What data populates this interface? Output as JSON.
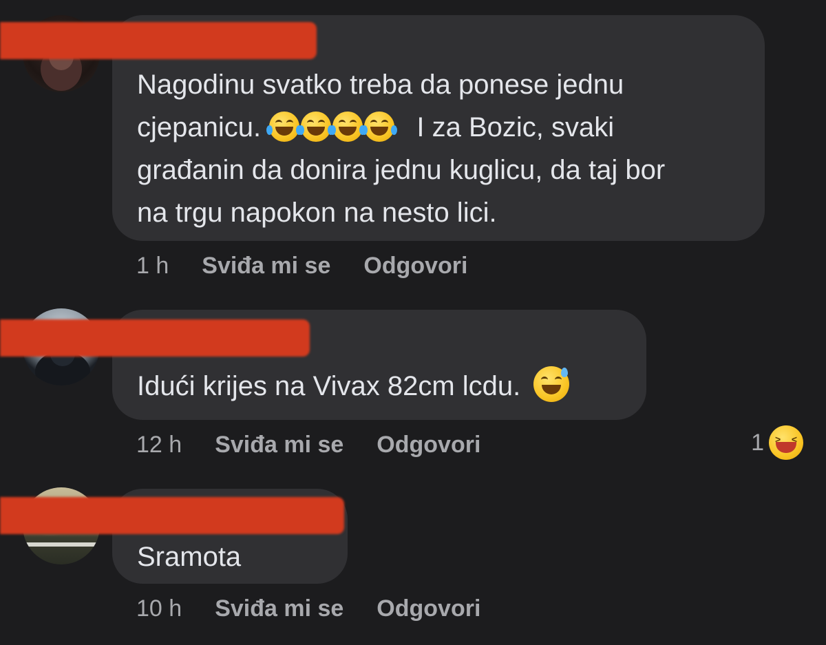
{
  "comments": [
    {
      "text_1": "Nagodinu svatko treba da ponese jednu",
      "text_2": "cjepanicu.",
      "text_2b": "I za Bozic, svaki",
      "text_3": "građanin da donira jednu kuglicu, da taj bor",
      "text_4": "na trgu napokon na nesto lici.",
      "emoji": "tears-of-joy-icon",
      "time": "1 h",
      "like": "Sviđa mi se",
      "reply": "Odgovori"
    },
    {
      "text_1": "Idući krijes na Vivax 82cm lcdu.",
      "emoji": "grinning-sweat-icon",
      "time": "12 h",
      "like": "Sviđa mi se",
      "reply": "Odgovori",
      "reaction_count": "1",
      "reaction_emoji": "laughing-squint-icon"
    },
    {
      "text_1": "Sramota",
      "time": "10 h",
      "like": "Sviđa mi se",
      "reply": "Odgovori"
    }
  ],
  "colors": {
    "background": "#1c1c1e",
    "bubble": "#303033",
    "redaction": "#d23a1e",
    "meta_text": "#a8a9ad"
  }
}
